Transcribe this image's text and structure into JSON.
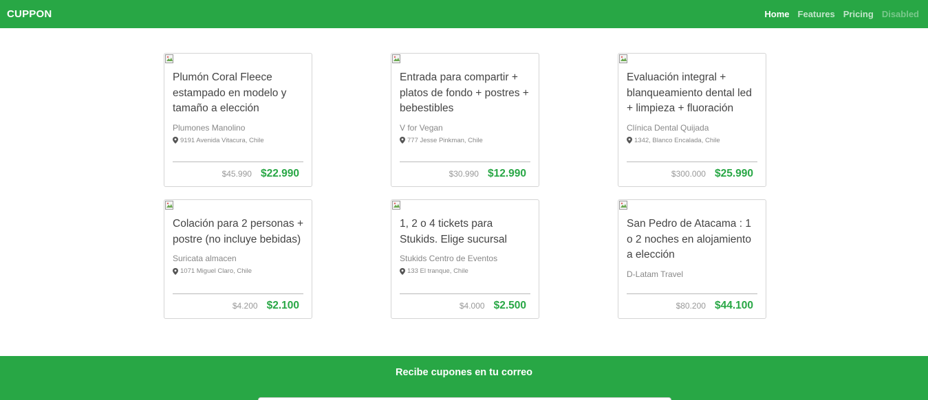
{
  "brand": "CUPPON",
  "nav": {
    "home": "Home",
    "features": "Features",
    "pricing": "Pricing",
    "disabled": "Disabled"
  },
  "colors": {
    "primary": "#28a745",
    "price": "#28a745"
  },
  "deals": [
    {
      "title": "Plumón Coral Fleece estampado en modelo y tamaño a elección",
      "merchant": "Plumones Manolino",
      "address": "9191 Avenida Vitacura, Chile",
      "old_price": "$45.990",
      "price": "$22.990"
    },
    {
      "title": "Entrada para compartir + platos de fondo + postres + bebestibles",
      "merchant": "V for Vegan",
      "address": "777 Jesse Pinkman, Chile",
      "old_price": "$30.990",
      "price": "$12.990"
    },
    {
      "title": "Evaluación integral + blanqueamiento dental led + limpieza + fluoración",
      "merchant": "Clínica Dental Quijada",
      "address": "1342, Blanco Encalada, Chile",
      "old_price": "$300.000",
      "price": "$25.990"
    },
    {
      "title": "Colación para 2 personas + postre (no incluye bebidas)",
      "merchant": "Suricata almacen",
      "address": "1071 Miguel Claro, Chile",
      "old_price": "$4.200",
      "price": "$2.100"
    },
    {
      "title": "1, 2 o 4 tickets para Stukids. Elige sucursal",
      "merchant": "Stukids Centro de Eventos",
      "address": "133 El tranque, Chile",
      "old_price": "$4.000",
      "price": "$2.500"
    },
    {
      "title": "San Pedro de Atacama : 1 o 2 noches en alojamiento a elección",
      "merchant": "D-Latam Travel",
      "address": "",
      "old_price": "$80.200",
      "price": "$44.100"
    }
  ],
  "footer": {
    "heading": "Recibe cupones en tu correo",
    "email_placeholder": ""
  }
}
